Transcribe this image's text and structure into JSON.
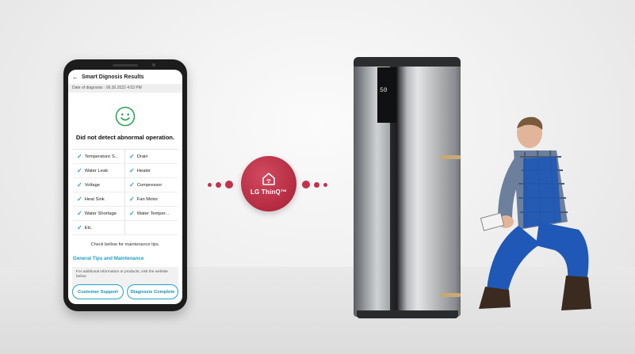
{
  "app": {
    "header_title": "Smart Dignosis Results",
    "date_line": "Date of diagnosis : 06.30.2022 4:53 PM",
    "status_message": "Did not detect abnormal operation.",
    "checks": [
      "Temperature S...",
      "Drain",
      "Water Leak",
      "Heater",
      "Voltage",
      "Compressor",
      "Heat Sink",
      "Fan Motor",
      "Water Shortage",
      "Water Temper...",
      "Etc."
    ],
    "tip_note": "Check bellow for maintenance tips.",
    "section_title": "General Tips and Maintenance",
    "info_text": "For additional information or products, visit the website below",
    "buttons": {
      "customer_support": "Customer Support",
      "diagnosis_complete": "Diagnosis Complete"
    }
  },
  "brand": {
    "logo_text": "LG ThinQ™",
    "accent_color": "#c2324a"
  },
  "heater": {
    "display_value": "50"
  },
  "icons": [
    "back-arrow-icon",
    "smiley-icon",
    "check-icon",
    "home-icon"
  ]
}
